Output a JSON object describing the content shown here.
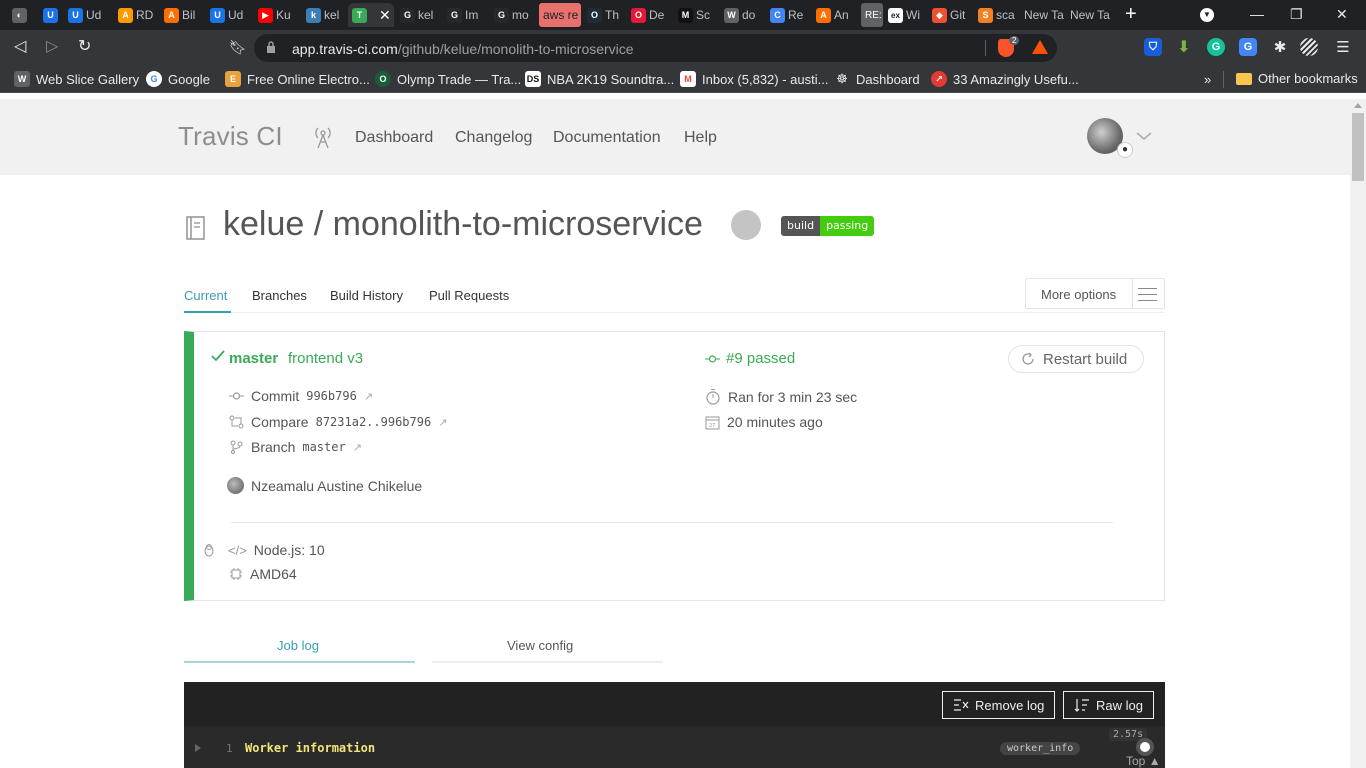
{
  "browser": {
    "tabs": [
      {
        "title": "",
        "favicon": "W",
        "color": "#888888"
      },
      {
        "title": "",
        "favicon": "U",
        "color": "#1a73e8"
      },
      {
        "title": "Ud",
        "favicon": "U",
        "color": "#1a73e8"
      },
      {
        "title": "RD",
        "favicon": "A",
        "color": "#ff9900"
      },
      {
        "title": "Bil",
        "favicon": "A",
        "color": "#ff6f00"
      },
      {
        "title": "Ud",
        "favicon": "U",
        "color": "#1a73e8"
      },
      {
        "title": "Ku",
        "favicon": "▶",
        "color": "#ff0000"
      },
      {
        "title": "kel",
        "favicon": "k",
        "color": "#3d7eb5"
      },
      {
        "title": "",
        "favicon": "T",
        "color": "#39aa56"
      },
      {
        "title": "kel",
        "favicon": "G",
        "color": "#24292e"
      },
      {
        "title": "Im",
        "favicon": "G",
        "color": "#24292e"
      },
      {
        "title": "mo",
        "favicon": "G",
        "color": "#24292e"
      },
      {
        "title": "aws re",
        "favicon": "",
        "color": "#e8716e"
      },
      {
        "title": "Th",
        "favicon": "O",
        "color": "#1f2b37"
      },
      {
        "title": "De",
        "favicon": "O",
        "color": "#e31937"
      },
      {
        "title": "Sc",
        "favicon": "M",
        "color": "#111111"
      },
      {
        "title": "do",
        "favicon": "W",
        "color": "#888888"
      },
      {
        "title": "Re",
        "favicon": "C",
        "color": "#4285f4"
      },
      {
        "title": "An",
        "favicon": "A",
        "color": "#ff6f00"
      },
      {
        "title": "RE:",
        "favicon": "",
        "color": "#555555"
      },
      {
        "title": "Wi",
        "favicon": "ex",
        "color": "#222222"
      },
      {
        "title": "Git",
        "favicon": "◆",
        "color": "#f05032"
      },
      {
        "title": "sca",
        "favicon": "S",
        "color": "#f48024"
      },
      {
        "title": "New Ta",
        "favicon": "",
        "color": ""
      },
      {
        "title": "New Ta",
        "favicon": "",
        "color": ""
      }
    ],
    "url_domain": "app.travis-ci.com",
    "url_path": "/github/kelue/monolith-to-microservice",
    "brave_count": "2",
    "bookmarks": [
      {
        "label": "Web Slice Gallery",
        "icon": "W",
        "color": "#888888"
      },
      {
        "label": "Google",
        "icon": "G",
        "color": "#4285f4"
      },
      {
        "label": "Free Online Electro...",
        "icon": "E",
        "color": "#e6a23c"
      },
      {
        "label": "Olymp Trade — Tra...",
        "icon": "O",
        "color": "#1a5c3a"
      },
      {
        "label": "NBA 2K19 Soundtra...",
        "icon": "DS",
        "color": "#111111"
      },
      {
        "label": "Inbox (5,832) - austi...",
        "icon": "M",
        "color": "#ea4335"
      },
      {
        "label": "Dashboard",
        "icon": "☸",
        "color": "#555555"
      },
      {
        "label": "33 Amazingly Usefu...",
        "icon": "↗",
        "color": "#e53935"
      }
    ],
    "bookmarks_more": "»",
    "other_bookmarks": "Other bookmarks"
  },
  "travis": {
    "logo": "Travis CI",
    "nav": [
      "Dashboard",
      "Changelog",
      "Documentation",
      "Help"
    ]
  },
  "repo": {
    "owner": "kelue",
    "sep": "/",
    "name": "monolith-to-microservice",
    "badge_left": "build",
    "badge_right": "passing"
  },
  "subtabs": [
    "Current",
    "Branches",
    "Build History",
    "Pull Requests"
  ],
  "more_options": "More options",
  "build": {
    "branch": "master",
    "message": "frontend v3",
    "number": "#9 passed",
    "restart": "Restart build",
    "commit_label": "Commit",
    "commit_sha": "996b796",
    "compare_label": "Compare",
    "compare_range": "87231a2..996b796",
    "branch_label": "Branch",
    "branch_name": "master",
    "author": "Nzeamalu Austine Chikelue",
    "duration": "Ran for 3 min 23 sec",
    "finished": "20 minutes ago",
    "language": "Node.js: 10",
    "arch": "AMD64"
  },
  "log_tabs": [
    "Job log",
    "View config"
  ],
  "log": {
    "remove_btn": "Remove log",
    "raw_btn": "Raw log",
    "line_number": "1",
    "line_text": "Worker information",
    "timer": "2.57s",
    "tag": "worker_info",
    "top": "Top"
  }
}
